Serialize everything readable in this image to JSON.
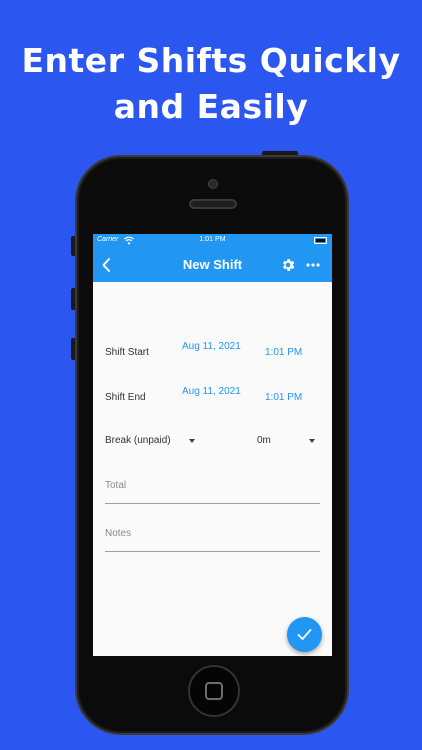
{
  "headline": {
    "line1": "Enter Shifts Quickly",
    "line2": "and Easily"
  },
  "status_bar": {
    "carrier": "Carrier",
    "time": "1:01 PM",
    "wifi_icon": "wifi-icon",
    "battery_icon": "battery-icon"
  },
  "app_bar": {
    "title": "New Shift",
    "back_icon": "chevron-left-icon",
    "settings_icon": "gear-icon",
    "more_icon": "more-horizontal-icon"
  },
  "form": {
    "shift_start": {
      "label": "Shift Start",
      "date": "Aug 11, 2021",
      "time": "1:01 PM"
    },
    "shift_end": {
      "label": "Shift End",
      "date": "Aug 11, 2021",
      "time": "1:01 PM"
    },
    "break": {
      "label": "Break (unpaid)",
      "value": "0m"
    },
    "total": {
      "label": "Total",
      "value": ""
    },
    "notes": {
      "label": "Notes",
      "value": ""
    }
  },
  "fab": {
    "icon": "check-icon"
  },
  "colors": {
    "background": "#2c56f0",
    "primary": "#2196f3",
    "screen": "#fafafa"
  }
}
